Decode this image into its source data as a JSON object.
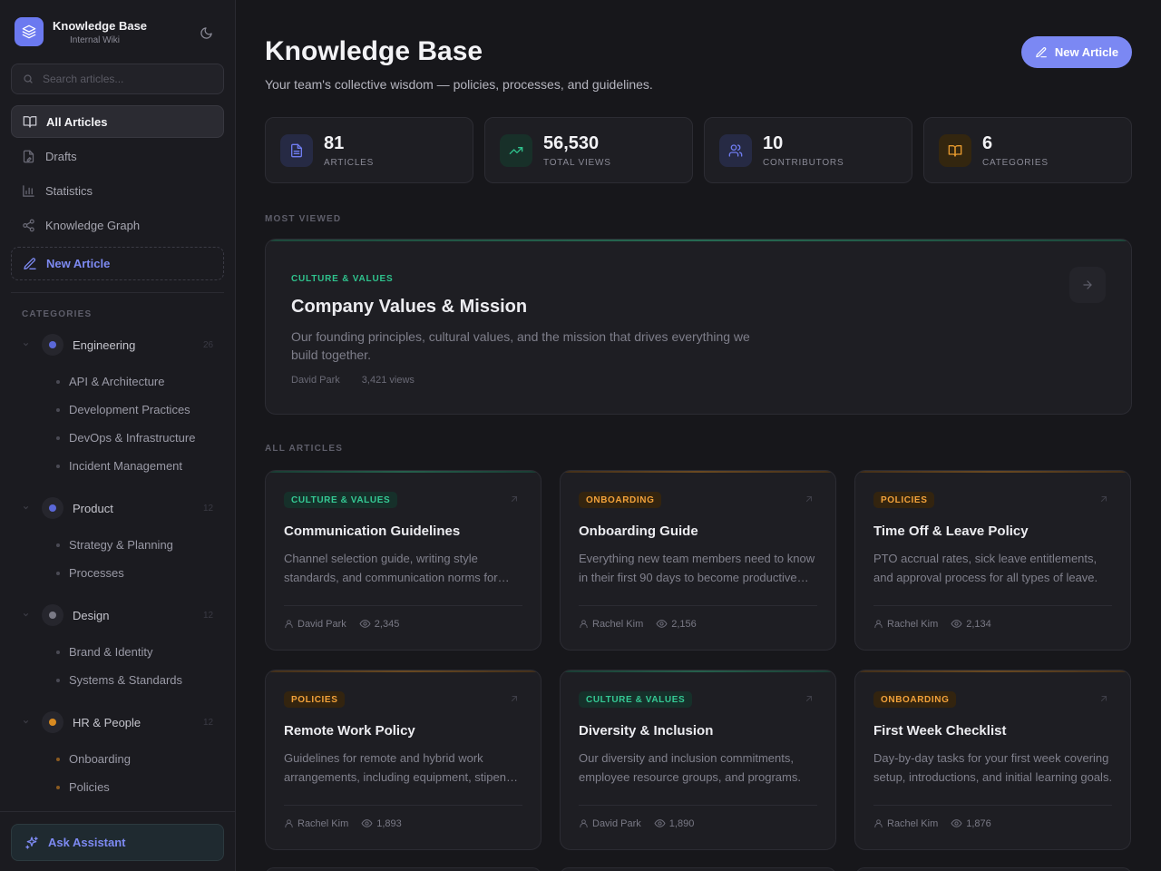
{
  "brand": {
    "title": "Knowledge Base",
    "subtitle": "Internal Wiki"
  },
  "search": {
    "placeholder": "Search articles..."
  },
  "nav": {
    "all_articles": "All Articles",
    "drafts": "Drafts",
    "statistics": "Statistics",
    "graph": "Knowledge Graph",
    "new_article": "New Article"
  },
  "categories_heading": "CATEGORIES",
  "categories": [
    {
      "name": "Engineering",
      "count": "26",
      "color": "#5b68d8",
      "subs": [
        "API & Architecture",
        "Development Practices",
        "DevOps & Infrastructure",
        "Incident Management"
      ]
    },
    {
      "name": "Product",
      "count": "12",
      "color": "#5b68d8",
      "subs": [
        "Strategy & Planning",
        "Processes"
      ]
    },
    {
      "name": "Design",
      "count": "12",
      "color": "#7a7a86",
      "subs": [
        "Brand & Identity",
        "Systems & Standards"
      ]
    },
    {
      "name": "HR & People",
      "count": "12",
      "color": "#d88a20",
      "subs": [
        "Onboarding",
        "Policies"
      ]
    }
  ],
  "assistant": {
    "label": "Ask Assistant"
  },
  "header": {
    "title": "Knowledge Base",
    "subtitle": "Your team's collective wisdom — policies, processes, and guidelines.",
    "new_button": "New Article"
  },
  "stats": [
    {
      "value": "81",
      "label": "ARTICLES",
      "icon": "document-icon",
      "color": "#6f7cf0",
      "bg": "#262a44"
    },
    {
      "value": "56,530",
      "label": "TOTAL VIEWS",
      "icon": "trending-up-icon",
      "color": "#2fc28d",
      "bg": "#183029"
    },
    {
      "value": "10",
      "label": "CONTRIBUTORS",
      "icon": "users-icon",
      "color": "#6f7cf0",
      "bg": "#262a44"
    },
    {
      "value": "6",
      "label": "CATEGORIES",
      "icon": "book-icon",
      "color": "#e79a2e",
      "bg": "#33260f"
    }
  ],
  "most_viewed_label": "MOST VIEWED",
  "featured": {
    "category": "CULTURE & VALUES",
    "title": "Company Values & Mission",
    "description": "Our founding principles, cultural values, and the mission that drives everything we build together.",
    "author": "David Park",
    "views": "3,421 views"
  },
  "all_articles_label": "ALL ARTICLES",
  "articles": [
    {
      "category": "CULTURE & VALUES",
      "tone": "green",
      "title": "Communication Guidelines",
      "description": "Channel selection guide, writing style standards, and communication norms for distributed teams.",
      "author": "David Park",
      "views": "2,345"
    },
    {
      "category": "ONBOARDING",
      "tone": "orange",
      "title": "Onboarding Guide",
      "description": "Everything new team members need to know in their first 90 days to become productive contributors.",
      "author": "Rachel Kim",
      "views": "2,156"
    },
    {
      "category": "POLICIES",
      "tone": "orange",
      "title": "Time Off & Leave Policy",
      "description": "PTO accrual rates, sick leave entitlements, and approval process for all types of leave.",
      "author": "Rachel Kim",
      "views": "2,134"
    },
    {
      "category": "POLICIES",
      "tone": "orange",
      "title": "Remote Work Policy",
      "description": "Guidelines for remote and hybrid work arrangements, including equipment, stipends and expectations.",
      "author": "Rachel Kim",
      "views": "1,893"
    },
    {
      "category": "CULTURE & VALUES",
      "tone": "green",
      "title": "Diversity & Inclusion",
      "description": "Our diversity and inclusion commitments, employee resource groups, and programs.",
      "author": "David Park",
      "views": "1,890"
    },
    {
      "category": "ONBOARDING",
      "tone": "orange",
      "title": "First Week Checklist",
      "description": "Day-by-day tasks for your first week covering setup, introductions, and initial learning goals.",
      "author": "Rachel Kim",
      "views": "1,876"
    }
  ]
}
